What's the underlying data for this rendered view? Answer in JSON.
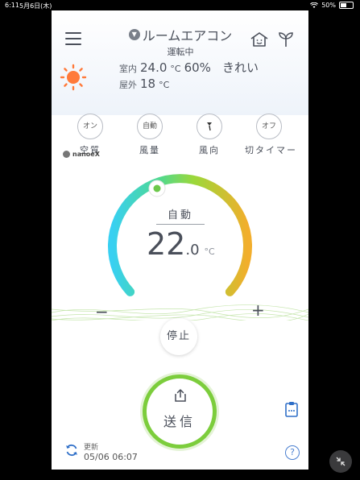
{
  "status_bar": {
    "time": "6:11",
    "date": "5月6日(木)",
    "battery": "50%"
  },
  "header": {
    "title": "ルームエアコン",
    "subtitle": "運転中"
  },
  "environment": {
    "indoor_label": "室内",
    "indoor_temp": "24.0",
    "indoor_unit": "°C",
    "humidity": "60%",
    "air_quality": "きれい",
    "outdoor_label": "屋外",
    "outdoor_temp": "18",
    "outdoor_unit": "°C"
  },
  "controls": [
    {
      "button": "オン",
      "label": "空質"
    },
    {
      "button": "自動",
      "label": "風量"
    },
    {
      "button": "",
      "label": "風向"
    },
    {
      "button": "オフ",
      "label": "切タイマー"
    }
  ],
  "brand": "nanoeX",
  "dial": {
    "mode": "自動",
    "temp_main": "22",
    "temp_frac": ".0",
    "unit": "°C",
    "minus": "−",
    "plus": "+"
  },
  "stop_button": "停止",
  "send_button": "送信",
  "update": {
    "label": "更新",
    "time": "05/06 06:07"
  },
  "help": "?",
  "icons": {
    "menu": "hamburger-icon",
    "dropdown": "chevron-down-icon",
    "home": "home-icon",
    "eco": "sprout-icon",
    "weather": "sun-icon",
    "fan_direction": "fan-direction-icon",
    "send": "upload-icon",
    "schedule": "clipboard-icon",
    "refresh": "refresh-icon",
    "float": "shrink-icon"
  },
  "colors": {
    "accent_green": "#7ccd3c",
    "dial_start": "#3ad3f0",
    "dial_end": "#f0b030",
    "sun": "#ff7a3a",
    "help_blue": "#4a7fd0"
  }
}
